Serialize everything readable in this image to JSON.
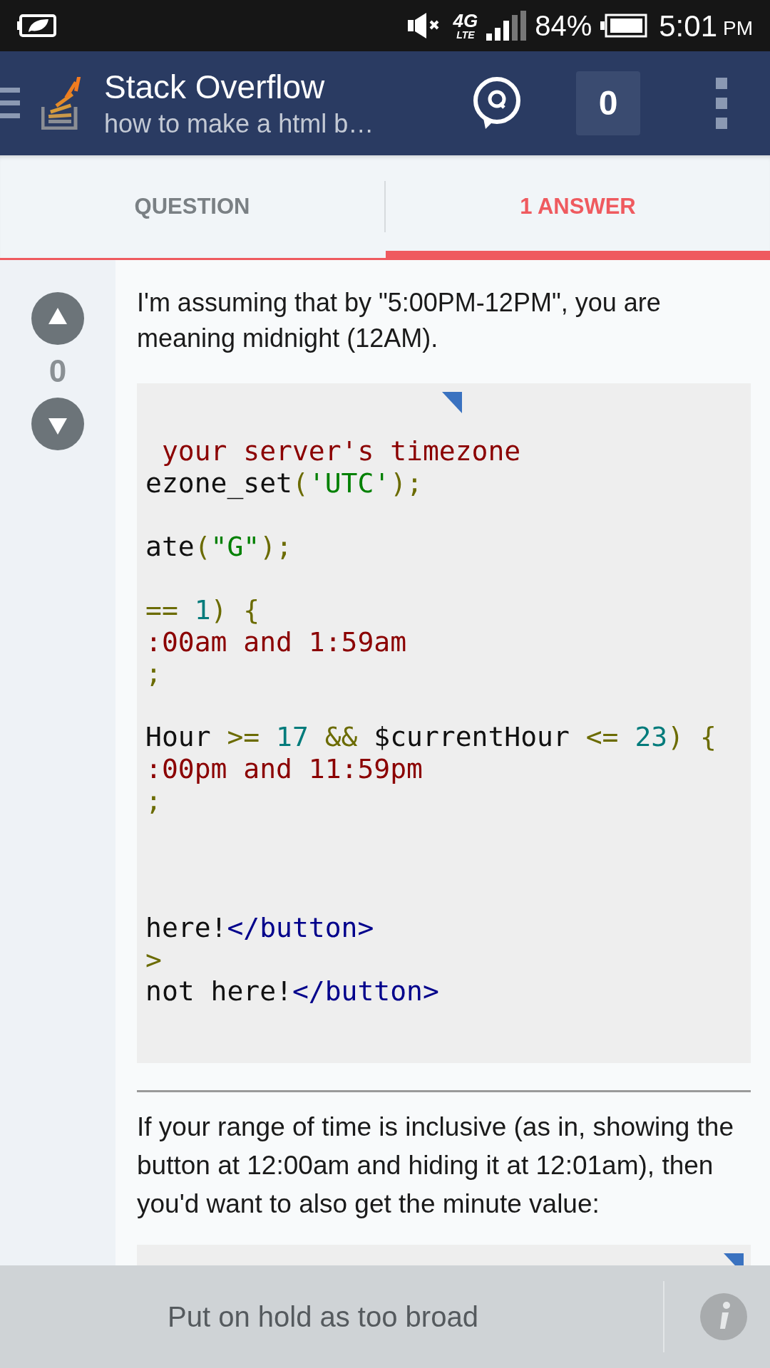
{
  "status_bar": {
    "network": "4G",
    "network_sub": "LTE",
    "battery": "84%",
    "time": "5:01",
    "ampm": "PM"
  },
  "header": {
    "title": "Stack Overflow",
    "subtitle": "how to make a html b…",
    "inbox_count": "0"
  },
  "tabs": [
    {
      "label": "QUESTION",
      "selected": false
    },
    {
      "label": "1 ANSWER",
      "selected": true
    }
  ],
  "answer": {
    "votes": "0",
    "intro": "I'm assuming that by \"5:00PM-12PM\", you are meaning midnight (12AM).",
    "code_groups": [
      [
        [
          {
            "kind": "comment",
            "text": " your server's timezone"
          }
        ],
        [
          {
            "kind": "plain",
            "text": "ezone_set"
          },
          {
            "kind": "punct",
            "text": "("
          },
          {
            "kind": "string",
            "text": "'UTC'"
          },
          {
            "kind": "punct",
            "text": ");"
          }
        ]
      ],
      [
        [
          {
            "kind": "plain",
            "text": "ate"
          },
          {
            "kind": "punct",
            "text": "("
          },
          {
            "kind": "string",
            "text": "\"G\""
          },
          {
            "kind": "punct",
            "text": ");"
          }
        ]
      ],
      [
        [
          {
            "kind": "punct",
            "text": "=="
          },
          {
            "kind": "number",
            "text": " 1"
          },
          {
            "kind": "punct",
            "text": ") {"
          }
        ],
        [
          {
            "kind": "comment",
            "text": ":00am and 1:59am"
          }
        ],
        [
          {
            "kind": "punct",
            "text": ";"
          }
        ]
      ],
      [
        [
          {
            "kind": "plain",
            "text": "Hour"
          },
          {
            "kind": "punct",
            "text": " >="
          },
          {
            "kind": "number",
            "text": " 17"
          },
          {
            "kind": "punct",
            "text": " &&"
          },
          {
            "kind": "plain",
            "text": " $currentHour"
          },
          {
            "kind": "punct",
            "text": " <="
          },
          {
            "kind": "number",
            "text": " 23"
          },
          {
            "kind": "punct",
            "text": ") {"
          }
        ],
        [
          {
            "kind": "comment",
            "text": ":00pm and 11:59pm"
          }
        ],
        [
          {
            "kind": "punct",
            "text": ";"
          }
        ]
      ],
      [
        [
          {
            "kind": "plain",
            "text": "here!"
          },
          {
            "kind": "tag",
            "text": "</button>"
          }
        ],
        [
          {
            "kind": "punct",
            "text": ">"
          }
        ],
        [
          {
            "kind": "plain",
            "text": "not here!"
          },
          {
            "kind": "tag",
            "text": "</button>"
          }
        ]
      ]
    ],
    "followup": "If your range of time is inclusive (as in, showing the button at 12:00am and hiding it at 12:01am), then you'd want to also get the minute value:"
  },
  "bottom_bar": {
    "label": "Put on hold as too broad"
  }
}
